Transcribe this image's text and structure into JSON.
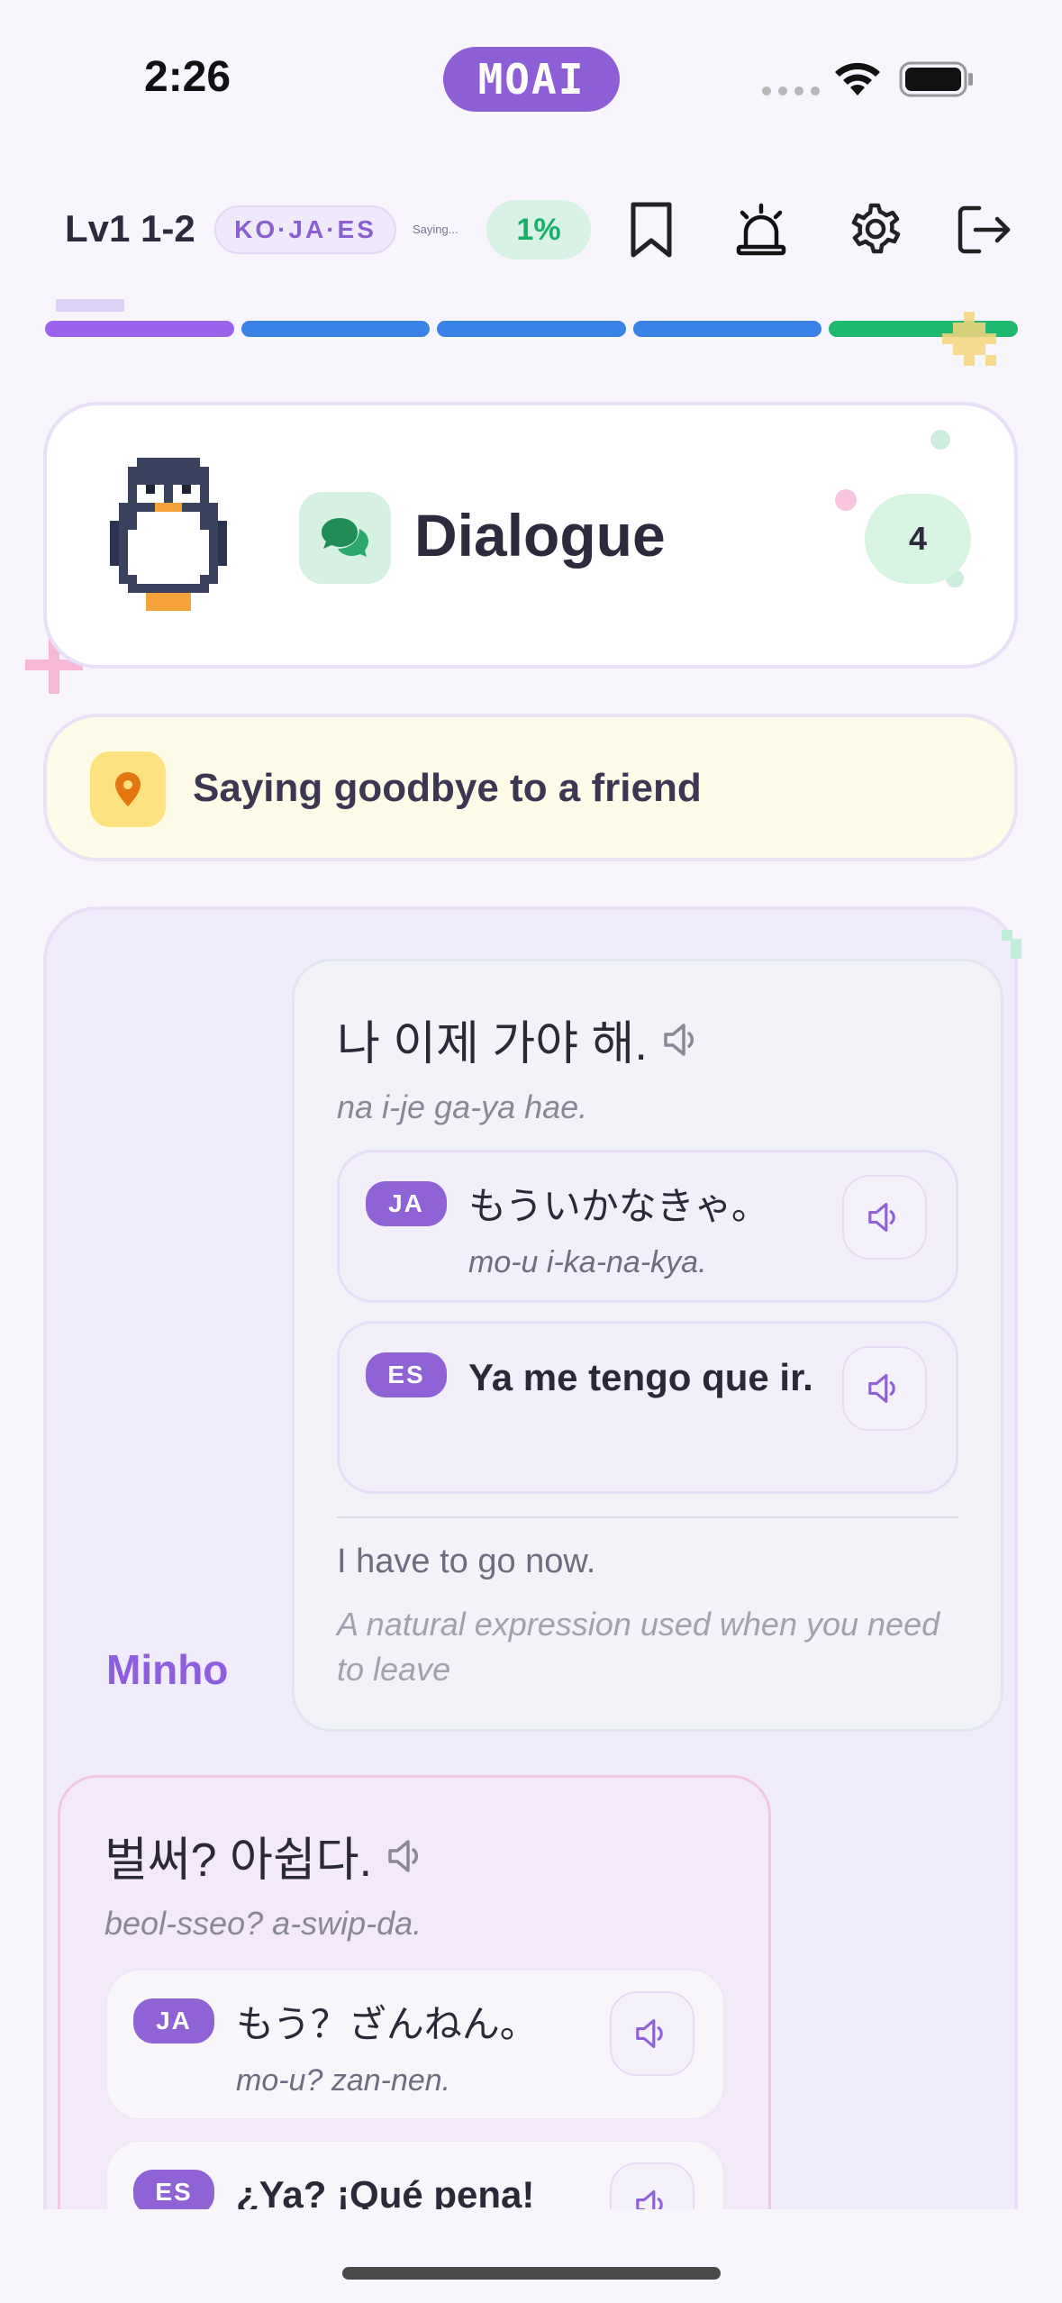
{
  "status_bar": {
    "time": "2:26",
    "brand": "MOAI"
  },
  "toolbar": {
    "level": "Lv1 1-2",
    "languages": "KO·JA·ES",
    "topic_short": "Saying...",
    "progress_percent": "1%",
    "icons": [
      "bookmark-icon",
      "alarm-icon",
      "gear-icon",
      "logout-icon"
    ]
  },
  "lesson_progress": {
    "segments": 5,
    "colors": [
      "#9b63ea",
      "#3b82e6",
      "#3b82e6",
      "#3b82e6",
      "#1fb86f"
    ]
  },
  "header": {
    "title": "Dialogue",
    "count": "4"
  },
  "situation": {
    "text": "Saying goodbye to a friend"
  },
  "dialogue": [
    {
      "speaker": "Minho",
      "text": "나 이제 가야 해.",
      "romanization": "na i-je ga-ya hae.",
      "translations": [
        {
          "lang": "JA",
          "text": "もういかなきゃ。",
          "romanization": "mo-u i-ka-na-kya."
        },
        {
          "lang": "ES",
          "text": "Ya me tengo que ir.",
          "romanization": ""
        }
      ],
      "meaning": "I have to go now.",
      "note": "A natural expression used when you need to leave"
    },
    {
      "text": "벌써? 아쉽다.",
      "romanization": "beol-sseo? a-swip-da.",
      "translations": [
        {
          "lang": "JA",
          "text": "もう？ざんねん。",
          "romanization": "mo-u? zan-nen."
        },
        {
          "lang": "ES",
          "text": "¿Ya? ¡Qué pena!",
          "romanization": ""
        }
      ]
    }
  ]
}
